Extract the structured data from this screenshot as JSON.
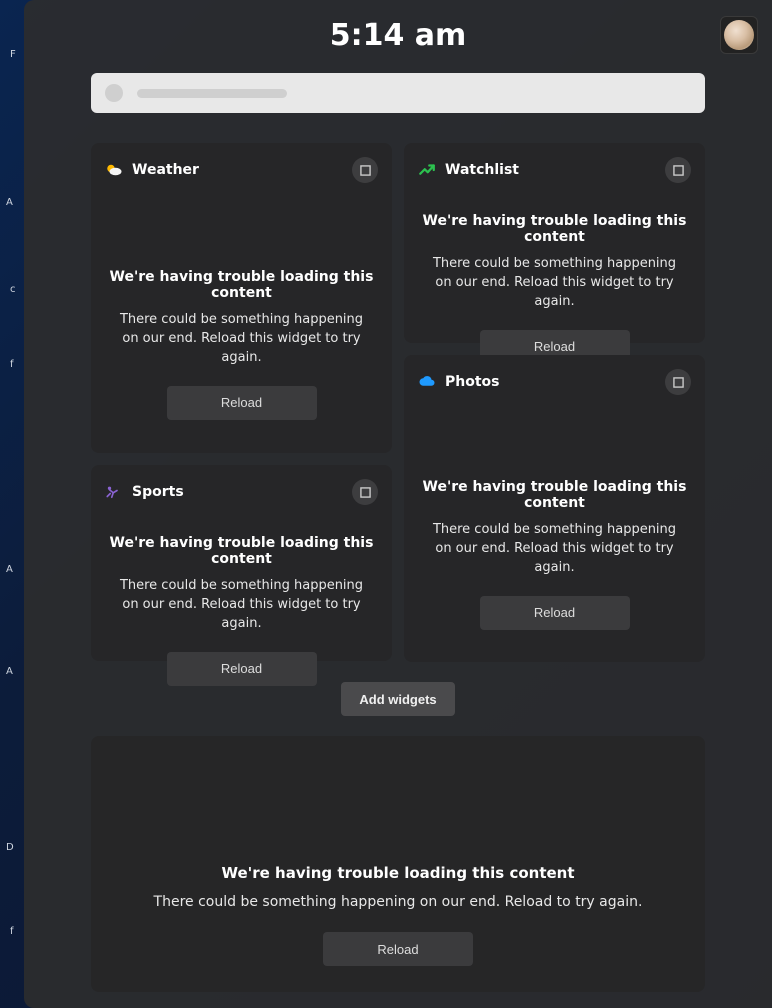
{
  "time": "5:14 am",
  "error": {
    "title": "We're having trouble loading this content",
    "subtitle": "There could be something happening on our end. Reload this widget to try again.",
    "reload": "Reload"
  },
  "widgets": {
    "weather": {
      "title": "Weather"
    },
    "watchlist": {
      "title": "Watchlist"
    },
    "sports": {
      "title": "Sports"
    },
    "photos": {
      "title": "Photos"
    }
  },
  "add_widgets": "Add widgets",
  "news": {
    "title": "We're having trouble loading this content",
    "subtitle": "There could be something happening on our end. Reload to try again.",
    "reload": "Reload"
  },
  "bg_fragments": [
    "F",
    "A",
    "c",
    "f",
    "A",
    "A",
    "D",
    "f"
  ]
}
